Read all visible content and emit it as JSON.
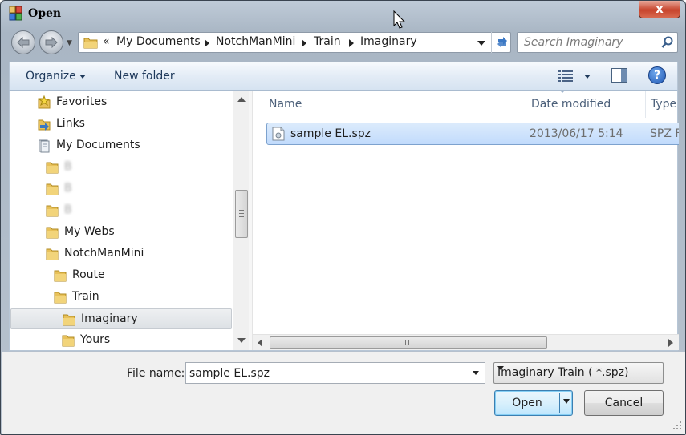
{
  "window": {
    "title": "Open",
    "close_label": "x"
  },
  "nav": {
    "back_label": "Back",
    "forward_label": "Forward"
  },
  "address": {
    "overflow": "«",
    "crumbs": [
      "My Documents",
      "NotchManMini",
      "Train",
      "Imaginary"
    ]
  },
  "search": {
    "placeholder": "Search Imaginary"
  },
  "toolbar": {
    "organize_label": "Organize",
    "new_folder_label": "New folder",
    "help_label": "?"
  },
  "tree": [
    {
      "label": "Favorites",
      "icon": "favorites-star-icon",
      "indent": 0,
      "blurred": false,
      "selected": false
    },
    {
      "label": "Links",
      "icon": "links-folder-icon",
      "indent": 0,
      "blurred": false,
      "selected": false
    },
    {
      "label": "My Documents",
      "icon": "documents-library-icon",
      "indent": 0,
      "blurred": false,
      "selected": false
    },
    {
      "label": "B",
      "icon": "folder-icon",
      "indent": 1,
      "blurred": true,
      "selected": false
    },
    {
      "label": "B",
      "icon": "folder-icon",
      "indent": 1,
      "blurred": true,
      "selected": false
    },
    {
      "label": "B",
      "icon": "folder-icon",
      "indent": 1,
      "blurred": true,
      "selected": false
    },
    {
      "label": "My Webs",
      "icon": "folder-icon",
      "indent": 1,
      "blurred": false,
      "selected": false
    },
    {
      "label": "NotchManMini",
      "icon": "folder-icon",
      "indent": 1,
      "blurred": false,
      "selected": false
    },
    {
      "label": "Route",
      "icon": "folder-icon",
      "indent": 2,
      "blurred": false,
      "selected": false
    },
    {
      "label": "Train",
      "icon": "folder-icon",
      "indent": 2,
      "blurred": false,
      "selected": false
    },
    {
      "label": "Imaginary",
      "icon": "folder-icon",
      "indent": 3,
      "blurred": false,
      "selected": true
    },
    {
      "label": "Yours",
      "icon": "folder-icon",
      "indent": 3,
      "blurred": false,
      "selected": false
    }
  ],
  "columns": {
    "name": "Name",
    "date_modified": "Date modified",
    "type": "Type"
  },
  "files": [
    {
      "name": "sample EL.spz",
      "date_modified": "2013/06/17 5:14",
      "type": "SPZ F",
      "icon": "spz-file-icon"
    }
  ],
  "footer": {
    "file_name_label": "File name:",
    "file_name_value": "sample EL.spz",
    "filter_value": "Imaginary Train ( *.spz)",
    "open_label": "Open",
    "cancel_label": "Cancel"
  },
  "colors": {
    "accent": "#3c7fb1",
    "selection": "#c1dbfc",
    "close_red": "#c7442c"
  }
}
